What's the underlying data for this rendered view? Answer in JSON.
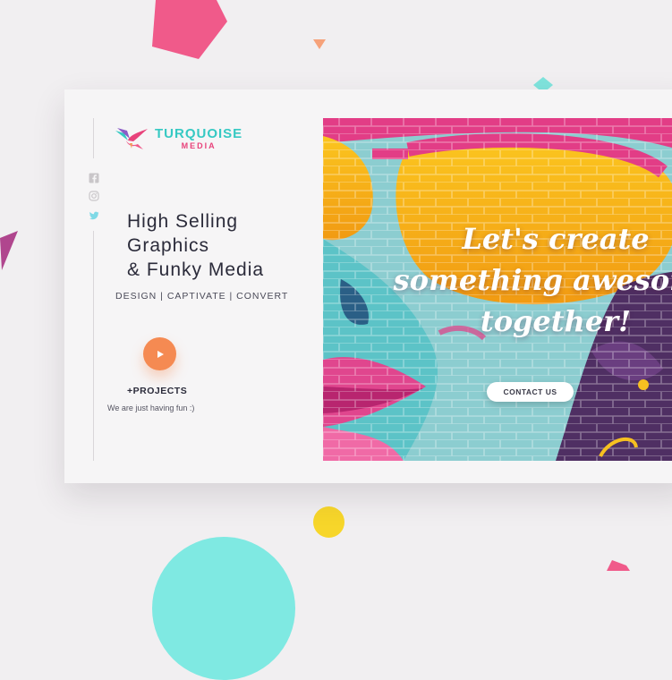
{
  "logo": {
    "name": "TURQUOISE",
    "sub": "MEDIA"
  },
  "social": [
    "facebook-icon",
    "instagram-icon",
    "twitter-icon"
  ],
  "headline": {
    "line1": "High Selling",
    "line2": "Graphics",
    "line3": "& Funky Media"
  },
  "tagline": "DESIGN | CAPTIVATE | CONVERT",
  "play_button": {
    "icon": "play-icon"
  },
  "projects": {
    "label": "+PROJECTS",
    "caption": "We are just having fun :)"
  },
  "hero": {
    "line1": "Let's create",
    "line2": "something awesome",
    "line3": "together!",
    "cta": "CONTACT US"
  },
  "colors": {
    "turquoise": "#36c9c3",
    "pink": "#e8437b",
    "orange": "#f58a52",
    "yellow": "#f7d62a",
    "background": "#f1eff1"
  }
}
